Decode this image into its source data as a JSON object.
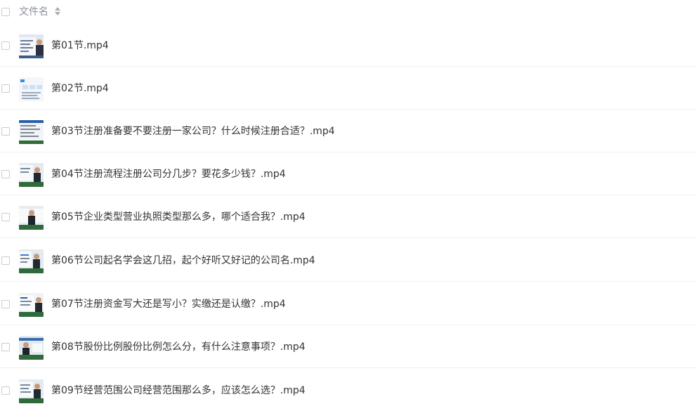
{
  "header": {
    "column_label": "文件名",
    "sort_icon": "sort-icon"
  },
  "files": [
    {
      "name": "第01节.mp4",
      "thumbnail": "presenter-slide-thumbnail"
    },
    {
      "name": "第02节.mp4",
      "thumbnail": "document-slide-thumbnail"
    },
    {
      "name": "第03节注册准备要不要注册一家公司？什么时候注册合适？.mp4",
      "thumbnail": "text-slide-thumbnail"
    },
    {
      "name": "第04节注册流程注册公司分几步？要花多少钱？.mp4",
      "thumbnail": "presenter-video-thumbnail"
    },
    {
      "name": "第05节企业类型营业执照类型那么多，哪个适合我？.mp4",
      "thumbnail": "presenter-video-thumbnail"
    },
    {
      "name": "第06节公司起名学会这几招，起个好听又好记的公司名.mp4",
      "thumbnail": "presenter-video-thumbnail"
    },
    {
      "name": "第07节注册资金写大还是写小？实缴还是认缴？.mp4",
      "thumbnail": "presenter-video-thumbnail"
    },
    {
      "name": "第08节股份比例股份比例怎么分，有什么注意事项？.mp4",
      "thumbnail": "presenter-video-thumbnail"
    },
    {
      "name": "第09节经营范围公司经营范围那么多，应该怎么选？.mp4",
      "thumbnail": "presenter-video-thumbnail"
    }
  ]
}
